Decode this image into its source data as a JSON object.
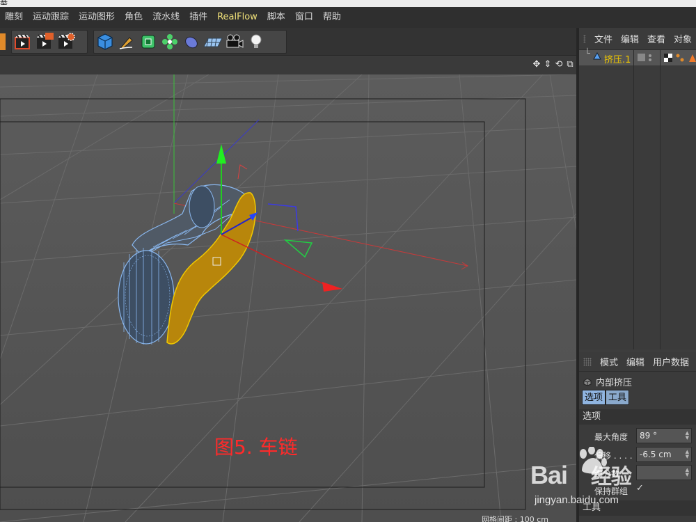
{
  "window": {
    "title_fragment": "基"
  },
  "menu": {
    "items": [
      {
        "label": "雕刻"
      },
      {
        "label": "运动跟踪"
      },
      {
        "label": "运动图形"
      },
      {
        "label": "角色"
      },
      {
        "label": "流水线"
      },
      {
        "label": "插件"
      },
      {
        "label": "RealFlow"
      },
      {
        "label": "脚本"
      },
      {
        "label": "窗口"
      },
      {
        "label": "帮助"
      }
    ]
  },
  "toolbar": {
    "groups": [
      {
        "icons": [
          "render-active-view-icon",
          "render-to-picture-viewer-icon",
          "render-settings-icon"
        ]
      },
      {
        "icons": [
          "cube-icon",
          "pen-icon",
          "subdivision-icon",
          "array-icon",
          "deformer-icon",
          "floor-icon",
          "camera-icon",
          "light-icon"
        ]
      }
    ]
  },
  "viewport": {
    "nav_icons": [
      "move-view-icon",
      "zoom-view-icon",
      "rotate-view-icon",
      "maximize-view-icon"
    ],
    "caption": "图5. 车链",
    "grid_status": "网格间距 : 100 cm"
  },
  "object_manager": {
    "tabs": [
      "文件",
      "编辑",
      "查看",
      "对象"
    ],
    "objects": [
      {
        "name": "挤压.1"
      }
    ]
  },
  "attribute_manager": {
    "tabs": [
      "模式",
      "编辑",
      "用户数据"
    ],
    "title": "内部挤压",
    "segments": [
      "选项",
      "工具"
    ],
    "section_options": "选项",
    "props": [
      {
        "label": "最大角度",
        "value": "89 °"
      },
      {
        "label": "偏移 . . . .",
        "value": "-6.5 cm"
      },
      {
        "label": "细分数",
        "value": ""
      }
    ],
    "checkbox_label": "保持群组",
    "section_tools": "工具"
  },
  "watermark": {
    "brand": "Bai",
    "brand_cn": "经验",
    "url": "jingyan.baidu.com"
  },
  "colors": {
    "selection_yellow": "#f0c800",
    "caption_red": "#ff2a2a",
    "menu_highlight": "#f1e27a"
  }
}
